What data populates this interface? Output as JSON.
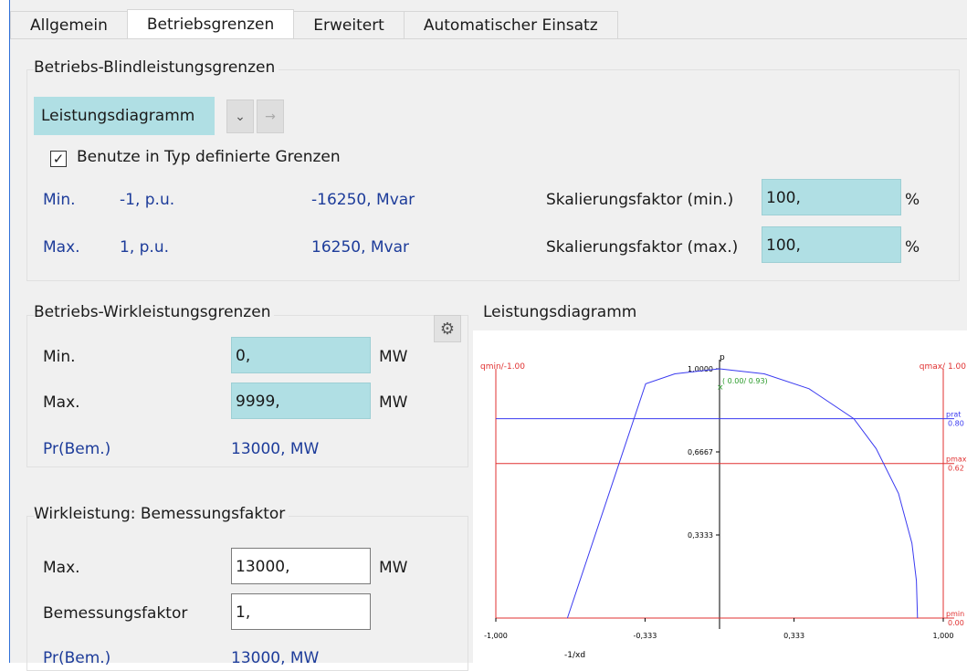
{
  "tabs": [
    "Allgemein",
    "Betriebsgrenzen",
    "Erweitert",
    "Automatischer Einsatz"
  ],
  "active_tab": "Betriebsgrenzen",
  "blind": {
    "title": "Betriebs-Blindleistungsgrenzen",
    "mode_label": "Leistungsdiagramm",
    "checkbox_label": "Benutze in Typ definierte Grenzen",
    "checkbox_checked": true,
    "min_label": "Min.",
    "min_pu": "-1, p.u.",
    "min_mvar": "-16250, Mvar",
    "max_label": "Max.",
    "max_pu": "1, p.u.",
    "max_mvar": "16250, Mvar",
    "scale_min_label": "Skalierungsfaktor (min.)",
    "scale_min_value": "100,",
    "scale_max_label": "Skalierungsfaktor (max.)",
    "scale_max_value": "100,",
    "percent": "%"
  },
  "wirk": {
    "title": "Betriebs-Wirkleistungsgrenzen",
    "min_label": "Min.",
    "min_value": "0,",
    "max_label": "Max.",
    "max_value": "9999,",
    "unit": "MW",
    "pr_label": "Pr(Bem.)",
    "pr_value": "13000, MW"
  },
  "rating": {
    "title": "Wirkleistung: Bemessungsfaktor",
    "max_label": "Max.",
    "max_value": "13000,",
    "unit": "MW",
    "factor_label": "Bemessungsfaktor",
    "factor_value": "1,",
    "pr_label": "Pr(Bem.)",
    "pr_value": "13000, MW"
  },
  "diagram_title": "Leistungsdiagramm",
  "chart_data": {
    "type": "line",
    "xlim": [
      -1,
      1
    ],
    "ylim": [
      0,
      1
    ],
    "xticks": [
      "-1,000",
      "-0,333",
      "0,333",
      "1,000"
    ],
    "yticks": [
      "1,0000",
      "0,6667",
      "0,3333"
    ],
    "x_axis_label": "-1/xd",
    "y_axis_label": "p",
    "left_label": "qmin/-1.00",
    "right_label": "qmax/ 1.00",
    "hlines": [
      {
        "label": "prat",
        "value_label": "0.80",
        "y": 0.8,
        "color": "#3a3af0"
      },
      {
        "label": "pmax",
        "value_label": "0.62",
        "y": 0.62,
        "color": "#e03030"
      },
      {
        "label": "pmin",
        "value_label": "0.00",
        "y": 0.0,
        "color": "#e03030"
      }
    ],
    "point": {
      "x": 0.0,
      "y": 0.93,
      "label": "( 0.00/ 0.93)"
    },
    "curve": [
      {
        "x": -0.68,
        "y": 0.0
      },
      {
        "x": -0.33,
        "y": 0.94
      },
      {
        "x": -0.2,
        "y": 0.98
      },
      {
        "x": 0.0,
        "y": 1.0
      },
      {
        "x": 0.2,
        "y": 0.98
      },
      {
        "x": 0.4,
        "y": 0.92
      },
      {
        "x": 0.6,
        "y": 0.8
      },
      {
        "x": 0.7,
        "y": 0.68
      },
      {
        "x": 0.8,
        "y": 0.5
      },
      {
        "x": 0.86,
        "y": 0.3
      },
      {
        "x": 0.88,
        "y": 0.15
      },
      {
        "x": 0.885,
        "y": 0.0
      }
    ]
  }
}
